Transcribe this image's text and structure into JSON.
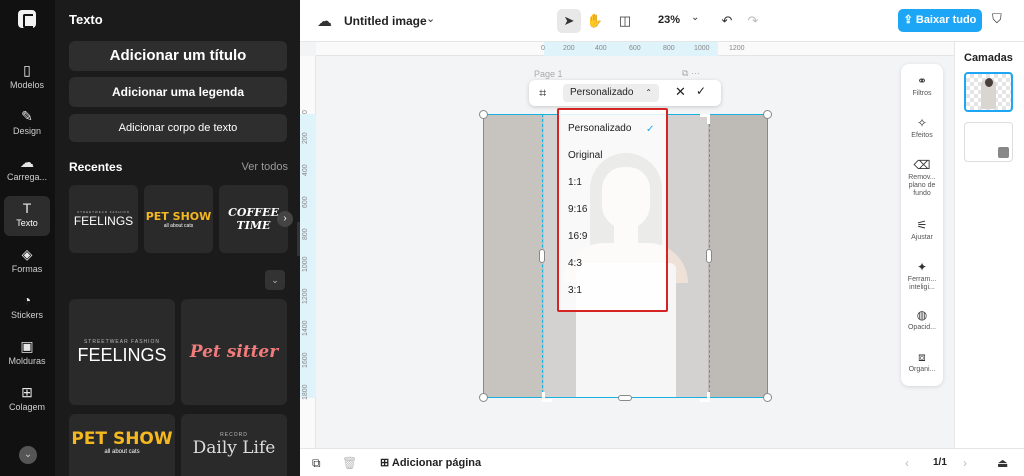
{
  "rail": {
    "items": [
      {
        "label": "Modelos",
        "icon": "template-icon"
      },
      {
        "label": "Design",
        "icon": "design-icon"
      },
      {
        "label": "Carrega...",
        "icon": "upload-icon"
      },
      {
        "label": "Texto",
        "icon": "text-icon"
      },
      {
        "label": "Formas",
        "icon": "shapes-icon"
      },
      {
        "label": "Stickers",
        "icon": "sticker-icon"
      },
      {
        "label": "Molduras",
        "icon": "frame-icon"
      },
      {
        "label": "Colagem",
        "icon": "collage-icon"
      }
    ],
    "active": "Texto"
  },
  "panel": {
    "title": "Texto",
    "add_title": "Adicionar um título",
    "add_subtitle": "Adicionar uma legenda",
    "add_body": "Adicionar corpo de texto",
    "recent_heading": "Recentes",
    "see_all": "Ver todos",
    "recent_tiles": [
      {
        "line1": "FEELINGS",
        "line2": "STREETWEAR FASHION"
      },
      {
        "line1": "PET SHOW",
        "line2": "all about cats"
      },
      {
        "line1": "COFFEE",
        "line2": "TIME"
      }
    ],
    "template_tiles": [
      {
        "line1": "FEELINGS",
        "line2": "STREETWEAR FASHION"
      },
      {
        "line1": "Pet sitter"
      },
      {
        "line1": "PET SHOW",
        "line2": "all about cats"
      },
      {
        "line1": "Daily Life",
        "line2": "RECORD"
      }
    ]
  },
  "topbar": {
    "title": "Untitled image",
    "zoom": "23%",
    "download": "Baixar tudo"
  },
  "canvas": {
    "ruler_h": [
      "0",
      "200",
      "400",
      "600",
      "800",
      "1000",
      "1200"
    ],
    "ruler_v": [
      "0",
      "200",
      "400",
      "600",
      "800",
      "1000",
      "1200",
      "1400",
      "1600",
      "1800"
    ],
    "page_label": "Page 1"
  },
  "crop": {
    "selected": "Personalizado",
    "options": [
      "Personalizado",
      "Original",
      "1:1",
      "9:16",
      "16:9",
      "4:3",
      "3:1"
    ]
  },
  "tools": [
    {
      "label": "Filtros",
      "icon": "filters-icon"
    },
    {
      "label": "Efeitos",
      "icon": "effects-icon"
    },
    {
      "label": "Remov... plano de fundo",
      "icon": "remove-bg-icon"
    },
    {
      "label": "Ajustar",
      "icon": "adjust-icon"
    },
    {
      "label": "Ferram... inteligi...",
      "icon": "magic-wand-icon"
    },
    {
      "label": "Opacid...",
      "icon": "opacity-icon"
    },
    {
      "label": "Organi...",
      "icon": "arrange-icon"
    }
  ],
  "layers": {
    "title": "Camadas"
  },
  "bottombar": {
    "add_page": "Adicionar página",
    "pages": "1/1"
  },
  "colors": {
    "accent": "#1da6f5",
    "selection": "#1ab0e0",
    "highlight_box": "#d62424"
  }
}
